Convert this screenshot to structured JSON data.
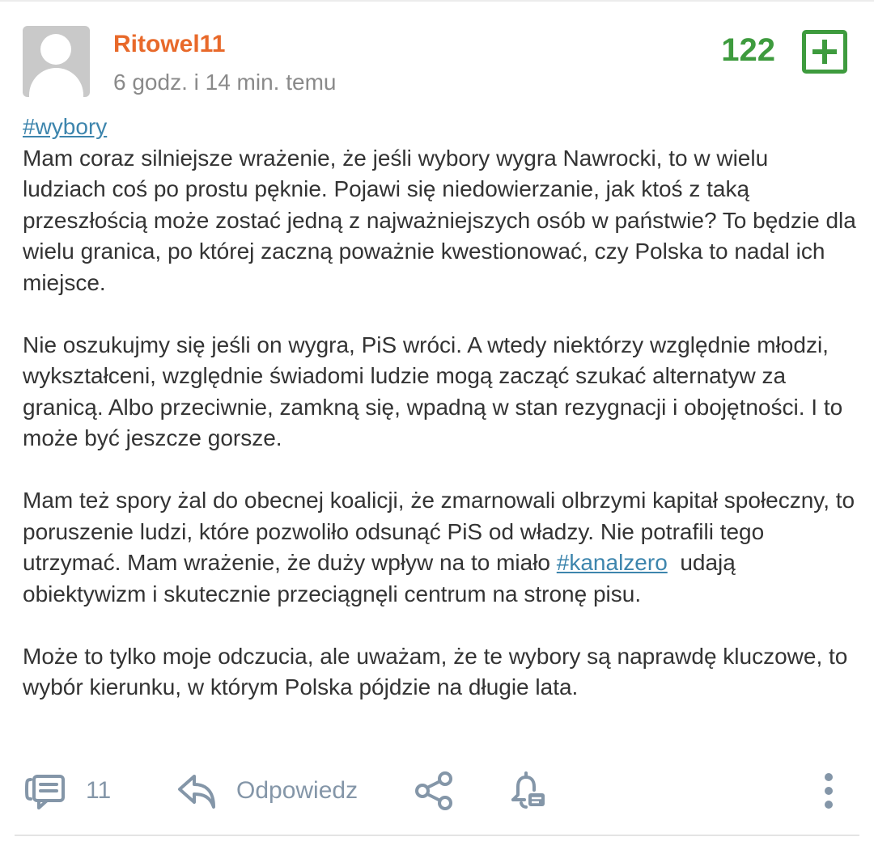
{
  "post": {
    "author": "Ritowel11",
    "time": "6 godz. i 14 min. temu",
    "votes": "122",
    "hashtag": "#wybory",
    "paragraph1": "Mam coraz silniejsze wrażenie, że jeśli wybory wygra Nawrocki, to w wielu ludziach coś po prostu pęknie. Pojawi się niedowierzanie, jak ktoś z taką przeszłością może zostać jedną z najważniejszych osób w państwie? To będzie dla wielu granica, po której zaczną poważnie kwestionować, czy Polska to nadal ich miejsce.",
    "paragraph2": "Nie oszukujmy się jeśli on wygra, PiS wróci. A wtedy niektórzy względnie młodzi, wykształceni, względnie świadomi ludzie mogą zacząć szukać alternatyw za granicą. Albo przeciwnie, zamkną się, wpadną w stan rezygnacji i obojętności. I to może być jeszcze gorsze.",
    "paragraph3_before": "Mam też spory żal do obecnej koalicji, że zmarnowali olbrzymi kapitał społeczny, to poruszenie ludzi, które pozwoliło odsunąć PiS od władzy. Nie potrafili tego utrzymać. Mam wrażenie, że duży wpływ na to miało ",
    "paragraph3_tag": "#kanalzero",
    "paragraph3_after": "  udają obiektywizm i skutecznie przeciągnęli centrum na stronę pisu.",
    "paragraph4": "Może to tylko moje odczucia, ale uważam, że te wybory są naprawdę kluczowe, to wybór kierunku, w którym Polska pójdzie na długie lata."
  },
  "actions": {
    "comments_count": "11",
    "reply_label": "Odpowiedz",
    "icons": [
      "comments-icon",
      "reply-icon",
      "share-icon",
      "notification-bell-icon",
      "more-vertical-icon"
    ]
  },
  "colors": {
    "author": "#e8692a",
    "vote_green": "#3e9b3e",
    "link": "#3d85ad",
    "action_gray": "#8496a8",
    "timestamp": "#8a8a8a"
  }
}
